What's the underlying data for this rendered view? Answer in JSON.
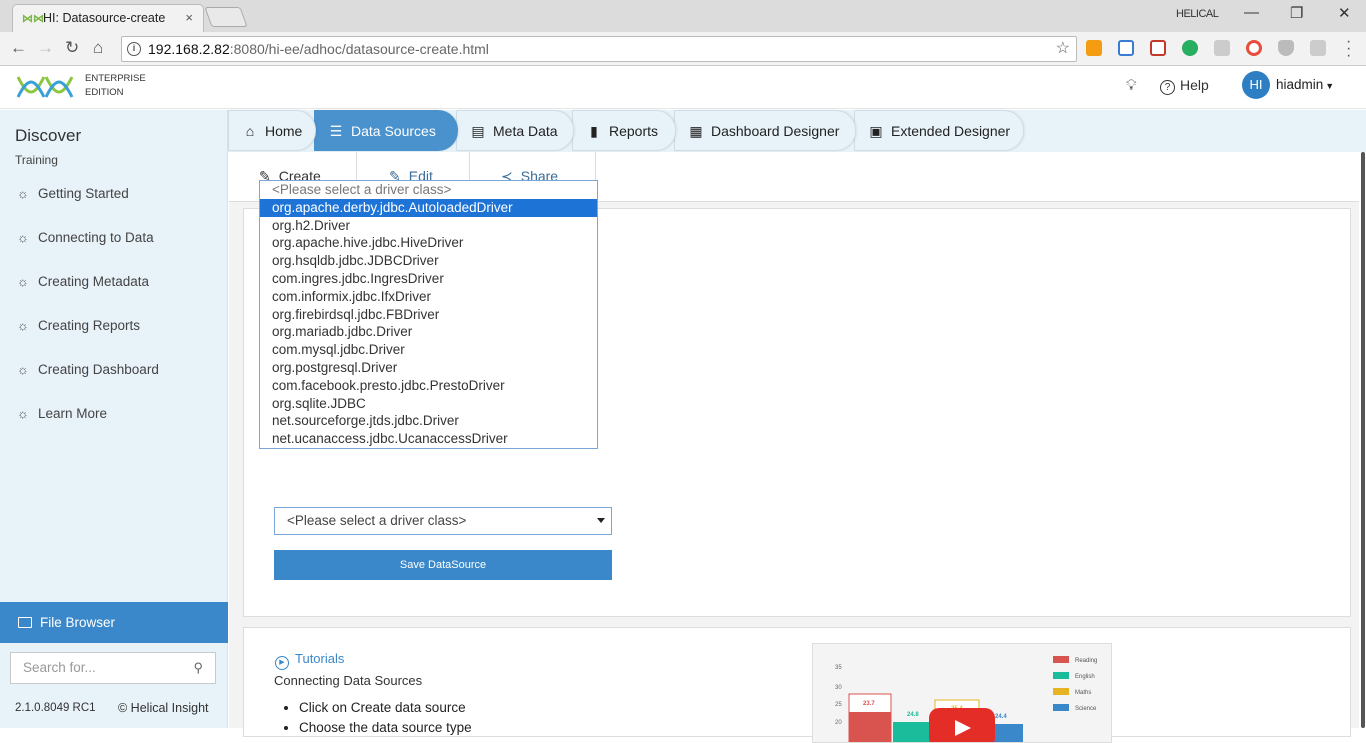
{
  "browser": {
    "tab_title": "HI: Datasource-create",
    "tab_close": "×",
    "window_user": "HELICAL",
    "url_host": "192.168.2.82",
    "url_rest": ":8080/hi-ee/adhoc/datasource-create.html"
  },
  "header": {
    "edition_line1": "ENTERPRISE",
    "edition_line2": "EDITION",
    "help_label": "Help",
    "avatar_initials": "HI",
    "username": "hiadmin"
  },
  "sidebar": {
    "title": "Discover",
    "subtitle": "Training",
    "items": [
      {
        "label": "Getting Started"
      },
      {
        "label": "Connecting to Data"
      },
      {
        "label": "Creating Metadata"
      },
      {
        "label": "Creating Reports"
      },
      {
        "label": "Creating Dashboard"
      },
      {
        "label": "Learn More"
      }
    ],
    "file_browser": "File Browser",
    "search_placeholder": "Search for...",
    "version": "2.1.0.8049 RC1",
    "copyright": "© Helical Insight"
  },
  "nav_tabs": [
    {
      "label": "Home"
    },
    {
      "label": "Data Sources",
      "active": true
    },
    {
      "label": "Meta Data"
    },
    {
      "label": "Reports"
    },
    {
      "label": "Dashboard Designer"
    },
    {
      "label": "Extended Designer"
    }
  ],
  "toolbar": {
    "create": "Create",
    "edit": "Edit",
    "share": "Share"
  },
  "driver_select": {
    "selected": "<Please select a driver class>",
    "highlighted": "org.apache.derby.jdbc.AutoloadedDriver",
    "options": [
      "<Please select a driver class>",
      "org.apache.derby.jdbc.AutoloadedDriver",
      "org.h2.Driver",
      "org.apache.hive.jdbc.HiveDriver",
      "org.hsqldb.jdbc.JDBCDriver",
      "com.ingres.jdbc.IngresDriver",
      "com.informix.jdbc.IfxDriver",
      "org.firebirdsql.jdbc.FBDriver",
      "org.mariadb.jdbc.Driver",
      "com.mysql.jdbc.Driver",
      "org.postgresql.Driver",
      "com.facebook.presto.jdbc.PrestoDriver",
      "org.sqlite.JDBC",
      "net.sourceforge.jtds.jdbc.Driver",
      "net.ucanaccess.jdbc.UcanaccessDriver"
    ]
  },
  "save_button": "Save DataSource",
  "tutorials": {
    "title": "Tutorials",
    "subtitle": "Connecting Data Sources",
    "steps": [
      "Click on Create data source",
      "Choose the data source type"
    ]
  },
  "video_thumb": {
    "legend": [
      "Reading",
      "English",
      "Maths",
      "Science"
    ],
    "legend_colors": [
      "#d9534f",
      "#1abc9c",
      "#e6b422",
      "#3a88c9"
    ],
    "yticks": [
      "35",
      "30",
      "25",
      "20"
    ],
    "bar_labels": [
      "23.7",
      "24.8",
      "25.4",
      "24.4"
    ]
  }
}
